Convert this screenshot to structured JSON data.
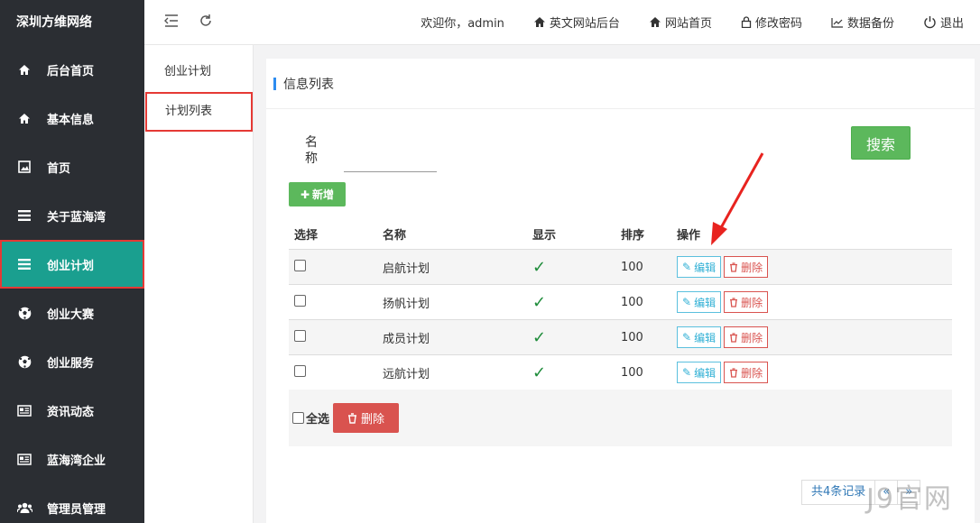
{
  "brand": "深圳方维网络",
  "sidebar": {
    "items": [
      {
        "label": "后台首页",
        "icon": "home-icon"
      },
      {
        "label": "基本信息",
        "icon": "home-icon"
      },
      {
        "label": "首页",
        "icon": "image-icon"
      },
      {
        "label": "关于蓝海湾",
        "icon": "list-icon"
      },
      {
        "label": "创业计划",
        "icon": "list-icon"
      },
      {
        "label": "创业大赛",
        "icon": "soccer-ball-icon"
      },
      {
        "label": "创业服务",
        "icon": "soccer-ball-icon"
      },
      {
        "label": "资讯动态",
        "icon": "newspaper-icon"
      },
      {
        "label": "蓝海湾企业",
        "icon": "newspaper-icon"
      },
      {
        "label": "管理员管理",
        "icon": "users-icon"
      }
    ],
    "active_index": 4,
    "active_color": "#1a9f8f"
  },
  "topbar": {
    "welcome": "欢迎你，admin",
    "links": [
      {
        "label": "英文网站后台",
        "icon": "home-icon"
      },
      {
        "label": "网站首页",
        "icon": "home-icon"
      },
      {
        "label": "修改密码",
        "icon": "lock-icon"
      },
      {
        "label": "数据备份",
        "icon": "chart-icon"
      },
      {
        "label": "退出",
        "icon": "power-icon"
      }
    ]
  },
  "submenu": {
    "items": [
      "创业计划",
      "计划列表"
    ],
    "active_index": 1
  },
  "panel": {
    "title": "信息列表",
    "search_label": "名称",
    "search_value": "",
    "search_button": "搜索",
    "add_button": "新增"
  },
  "table": {
    "headers": [
      "选择",
      "名称",
      "显示",
      "排序",
      "操作"
    ],
    "rows": [
      {
        "name": "启航计划",
        "shown": true,
        "sort": "100"
      },
      {
        "name": "扬帆计划",
        "shown": true,
        "sort": "100"
      },
      {
        "name": "成员计划",
        "shown": true,
        "sort": "100"
      },
      {
        "name": "远航计划",
        "shown": true,
        "sort": "100"
      }
    ],
    "edit_label": "编辑",
    "delete_label": "删除"
  },
  "footer": {
    "select_all": "全选",
    "delete_button": "删除"
  },
  "pager": {
    "info": "共4条记录",
    "prev": "«",
    "next": "»"
  },
  "watermark": "J9官网",
  "colors": {
    "sidebar_bg": "#2b2e33",
    "success": "#5cb85c",
    "danger": "#d9534f",
    "info": "#5bc0de",
    "highlight_border": "#e53935"
  }
}
